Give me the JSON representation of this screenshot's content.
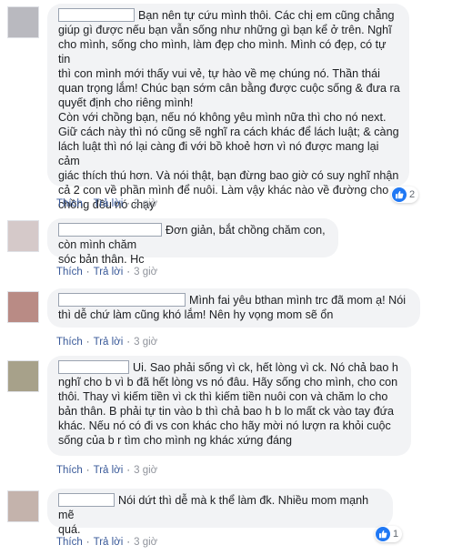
{
  "comments": [
    {
      "avatar_color": "#b9b9bf",
      "text": "Bạn nên tự cứu mình thôi. Các chị em cũng chẳng\ngiúp gì được nếu bạn vẫn sống như những gì bạn kể ở trên. Nghĩ\ncho mình, sống cho mình, làm đẹp cho mình. Mình có đẹp, có tự tin\nthì con mình mới thấy vui vẻ, tự hào về mẹ chúng nó. Thần thái\nquan trọng lắm! Chúc bạn sớm cân bằng được cuộc sống & đưa ra\nquyết định cho riêng mình!\nCòn với chồng bạn, nếu nó không yêu mình nữa thì cho nó next.\nGiữ cách này thì nó cũng sẽ nghĩ ra cách khác để lách luật; & càng\nlách luật thì nó lại càng đi với bồ khoẻ hơn vì nó được mang lại cảm\ngiác thích thú hơn. Và nói thật, bạn đừng bao giờ có suy nghĩ nhận\ncả 2 con về phần mình để nuôi. Làm vậy khác nào về đường cho\nchồng đều nó chạy",
      "like_label": "Thích",
      "reply_label": "Trả lời",
      "time": "3 giờ",
      "reaction_count": "2"
    },
    {
      "avatar_color": "#d5c9c9",
      "text": "Đơn giản, bắt chồng chăm con, còn mình chăm\nsóc bản thân. Hc",
      "like_label": "Thích",
      "reply_label": "Trả lời",
      "time": "3 giờ"
    },
    {
      "avatar_color": "#b98b85",
      "text": "Mình fai yêu bthan mình trc đã mom ạ! Nói\nthì dễ chứ làm cũng khó lắm! Nên hy vọng mom sẽ ổn",
      "like_label": "Thích",
      "reply_label": "Trả lời",
      "time": "3 giờ"
    },
    {
      "avatar_color": "#a7a18a",
      "text": "Ui. Sao phải sống vì ck, hết lòng vì ck. Nó chả bao h\nnghĩ cho b vì b đã hết lòng vs nó đâu. Hãy sống cho mình, cho con\nthôi. Thay vì kiếm tiền vì ck thì kiếm tiền nuôi con và chăm lo cho\nbản thân. B phải tự tin vào b thì chả bao h b lo mất ck vào tay đứa\nkhác. Nếu nó có đi vs con khác cho hãy mời nó lượn ra khỏi cuộc\nsống của b r tìm cho mình ng khác xứng đáng",
      "like_label": "Thích",
      "reply_label": "Trả lời",
      "time": "3 giờ"
    },
    {
      "avatar_color": "#c4b3ac",
      "text": "Nói dứt thì dễ mà k thể làm đk. Nhiều mom mạnh mẽ\nquá.",
      "like_label": "Thích",
      "reply_label": "Trả lời",
      "time": "3 giờ",
      "reaction_count": "1"
    }
  ]
}
